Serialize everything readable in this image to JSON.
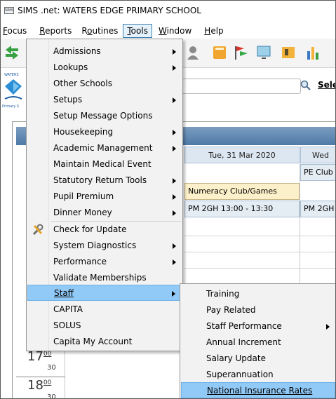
{
  "window": {
    "app_icon_text": "SIMS",
    "title": "SIMS .net: WATERS EDGE PRIMARY SCHOOL"
  },
  "menubar": {
    "items": [
      {
        "label": "Focus"
      },
      {
        "label": "Reports"
      },
      {
        "label": "Routines"
      },
      {
        "label": "Tools"
      },
      {
        "label": "Window"
      },
      {
        "label": "Help"
      }
    ]
  },
  "search": {
    "button_label": "Sele"
  },
  "calendar": {
    "columns": [
      {
        "label": "Tue, 31 Mar 2020"
      },
      {
        "label": "Wed"
      }
    ],
    "events": [
      {
        "label": "PE Club"
      },
      {
        "label": "Numeracy Club/Games"
      },
      {
        "label": "PM 2GH  13:00 - 13:30"
      },
      {
        "label": "PM 2GH"
      }
    ],
    "times": [
      {
        "hour": "17",
        "minutes": "00",
        "half": "30"
      },
      {
        "hour": "18",
        "minutes": "00",
        "half": "30"
      }
    ]
  },
  "tools_menu": {
    "items": [
      {
        "label": "Admissions",
        "submenu": true
      },
      {
        "label": "Lookups",
        "submenu": true
      },
      {
        "label": "Other Schools",
        "submenu": false
      },
      {
        "label": "Setups",
        "submenu": true
      },
      {
        "label": "Setup Message Options",
        "submenu": false
      },
      {
        "label": "Housekeeping",
        "submenu": true
      },
      {
        "label": "Academic Management",
        "submenu": true
      },
      {
        "label": "Maintain Medical Event",
        "submenu": false
      },
      {
        "label": "Statutory Return Tools",
        "submenu": true
      },
      {
        "label": "Pupil Premium",
        "submenu": true
      },
      {
        "label": "Dinner Money",
        "submenu": true
      },
      {
        "label": "Check for Update",
        "submenu": false,
        "icon": "tools-icon"
      },
      {
        "label": "System Diagnostics",
        "submenu": true
      },
      {
        "label": "Performance",
        "submenu": true
      },
      {
        "label": "Validate Memberships",
        "submenu": false
      },
      {
        "label": "Staff",
        "submenu": true,
        "highlighted": true
      },
      {
        "label": "CAPITA",
        "submenu": false
      },
      {
        "label": "SOLUS",
        "submenu": false
      },
      {
        "label": "Capita My Account",
        "submenu": false
      }
    ]
  },
  "staff_menu": {
    "items": [
      {
        "label": "Training",
        "submenu": false
      },
      {
        "label": "Pay Related",
        "submenu": false
      },
      {
        "label": "Staff Performance",
        "submenu": true
      },
      {
        "label": "Annual Increment",
        "submenu": false
      },
      {
        "label": "Salary Update",
        "submenu": false
      },
      {
        "label": "Superannuation",
        "submenu": false
      },
      {
        "label": "National Insurance Rates",
        "submenu": false,
        "highlighted": true
      }
    ]
  },
  "colors": {
    "highlight": "#91c9f7",
    "menu_bg": "#f2f2f2",
    "calendar_header": "#4e7aa8"
  }
}
